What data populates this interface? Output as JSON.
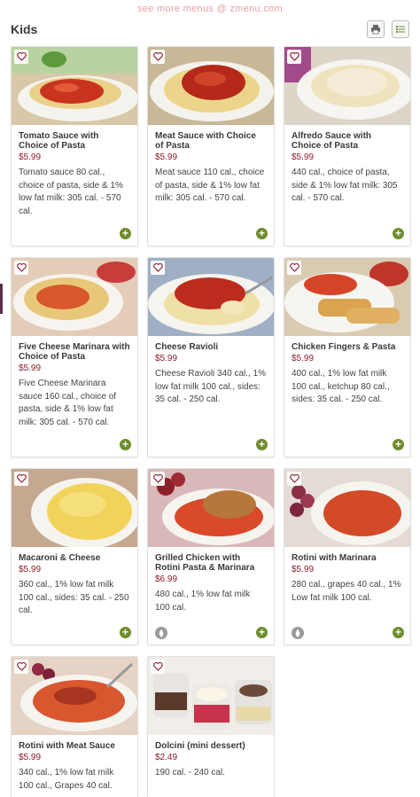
{
  "watermark": "see more menus @ zmenu.com",
  "header": {
    "title": "Kids",
    "print_icon": "printer-icon",
    "view_icon": "list-view-icon"
  },
  "colors": {
    "price": "#8a1c2b",
    "add_button": "#6f8d2e",
    "accent_bar": "#5a2d4a"
  },
  "items": [
    {
      "name": "Tomato Sauce with Choice of Pasta",
      "price": "$5.99",
      "desc": "Tomato sauce 80 cal., choice of pasta, side & 1% low fat milk: 305 cal. - 570 cal.",
      "icon": "plus-icon"
    },
    {
      "name": "Meat Sauce with Choice of Pasta",
      "price": "$5.99",
      "desc": "Meat sauce 110 cal., choice of pasta, side & 1% low fat milk: 305 cal. - 570 cal.",
      "icon": "plus-icon"
    },
    {
      "name": "Alfredo Sauce with Choice of Pasta",
      "price": "$5.99",
      "desc": "440 cal., choice of pasta, side & 1% low fat milk: 305 cal. - 570 cal.",
      "icon": "plus-icon"
    },
    {
      "name": "Five Cheese Marinara with Choice of Pasta",
      "price": "$5.99",
      "desc": "Five Cheese Marinara sauce 160 cal., choice of pasta, side & 1% low fat milk: 305 cal. - 570 cal.",
      "icon": "plus-icon"
    },
    {
      "name": "Cheese Ravioli",
      "price": "$5.99",
      "desc": "Cheese Ravioli 340 cal., 1% low fat milk 100 cal., sides: 35 cal. - 250 cal.",
      "icon": "plus-icon"
    },
    {
      "name": "Chicken Fingers & Pasta",
      "price": "$5.99",
      "desc": "400 cal., 1% low fat milk 100 cal., ketchup 80 cal., sides: 35 cal. - 250 cal.",
      "icon": "plus-icon"
    },
    {
      "name": "Macaroni & Cheese",
      "price": "$5.99",
      "desc": "360 cal., 1% low fat milk 100 cal., sides: 35 cal. - 250 cal.",
      "icon": "plus-icon"
    },
    {
      "name": "Grilled Chicken with Rotini Pasta & Marinara",
      "price": "$6.99",
      "desc": "480 cal., 1% low fat milk 100 cal.",
      "icon": "plus-icon"
    },
    {
      "name": "Rotini with Marinara",
      "price": "$5.99",
      "desc": "280 cal., grapes 40 cal., 1% Low fat milk 100 cal.",
      "icon": "plus-icon"
    },
    {
      "name": "Rotini with Meat Sauce",
      "price": "$5.99",
      "desc": "340 cal., 1% low fat milk 100 cal., Grapes 40 cal.",
      "icon": "plus-icon"
    },
    {
      "name": "Dolcini (mini dessert)",
      "price": "$2.49",
      "desc": "190 cal. - 240 cal.",
      "icon": "plus-icon"
    }
  ]
}
